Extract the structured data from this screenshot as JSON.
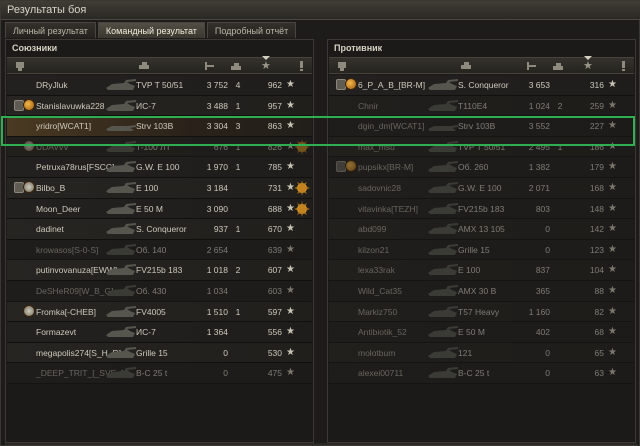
{
  "window": {
    "title": "Результаты боя"
  },
  "tabs": [
    {
      "label": "Личный результат",
      "active": false
    },
    {
      "label": "Командный результат",
      "active": true
    },
    {
      "label": "Подробный отчёт",
      "active": false
    }
  ],
  "allies": {
    "title": "Союзники",
    "rows": [
      {
        "player": "DRyJluk",
        "tank": "TVP T 50/51",
        "damage": "3 752",
        "kills": "4",
        "xp": "962",
        "rank": false,
        "clan": false,
        "dead": false,
        "self": false,
        "medal": false
      },
      {
        "player": "Stanislavuwka228",
        "tank": "ИС-7",
        "damage": "3 488",
        "kills": "1",
        "xp": "957",
        "rank": true,
        "clan": true,
        "dead": false,
        "self": false,
        "medal": false
      },
      {
        "player": "yridro[WCAT1]",
        "tank": "Strv 103B",
        "damage": "3 304",
        "kills": "3",
        "xp": "863",
        "rank": false,
        "clan": false,
        "dead": false,
        "self": true,
        "medal": false
      },
      {
        "player": "UDAVvV",
        "tank": "T-100 ЛТ",
        "damage": "676",
        "kills": "1",
        "xp": "826",
        "rank": false,
        "clan": true,
        "dead": true,
        "self": false,
        "medal": true
      },
      {
        "player": "Petruxa78rus[FSCC]",
        "tank": "G.W. E 100",
        "damage": "1 970",
        "kills": "1",
        "xp": "785",
        "rank": false,
        "clan": false,
        "dead": false,
        "self": false,
        "medal": false
      },
      {
        "player": "Bilbo_B",
        "tank": "E 100",
        "damage": "3 184",
        "kills": "",
        "xp": "731",
        "rank": true,
        "clan": true,
        "dead": false,
        "self": false,
        "medal": true
      },
      {
        "player": "Moon_Deer",
        "tank": "E 50 M",
        "damage": "3 090",
        "kills": "",
        "xp": "688",
        "rank": false,
        "clan": false,
        "dead": false,
        "self": false,
        "medal": true
      },
      {
        "player": "dadinet",
        "tank": "S. Conqueror",
        "damage": "937",
        "kills": "1",
        "xp": "670",
        "rank": false,
        "clan": false,
        "dead": false,
        "self": false,
        "medal": false
      },
      {
        "player": "krowasos[S-0-S]",
        "tank": "Об. 140",
        "damage": "2 654",
        "kills": "",
        "xp": "639",
        "rank": false,
        "clan": false,
        "dead": true,
        "self": false,
        "medal": false
      },
      {
        "player": "putinvovanuza[EWW]",
        "tank": "FV215b 183",
        "damage": "1 018",
        "kills": "2",
        "xp": "607",
        "rank": false,
        "clan": false,
        "dead": false,
        "self": false,
        "medal": false
      },
      {
        "player": "DeSHeR09[W_B_G]",
        "tank": "Об. 430",
        "damage": "1 034",
        "kills": "",
        "xp": "603",
        "rank": false,
        "clan": false,
        "dead": true,
        "self": false,
        "medal": false
      },
      {
        "player": "Fromka[-CHEB]",
        "tank": "FV4005",
        "damage": "1 510",
        "kills": "1",
        "xp": "597",
        "rank": false,
        "clan": true,
        "dead": false,
        "self": false,
        "medal": false
      },
      {
        "player": "Formazevt",
        "tank": "ИС-7",
        "damage": "1 364",
        "kills": "",
        "xp": "556",
        "rank": false,
        "clan": false,
        "dead": false,
        "self": false,
        "medal": false
      },
      {
        "player": "megapolis274[S_H_R]",
        "tank": "Grille 15",
        "damage": "0",
        "kills": "",
        "xp": "530",
        "rank": false,
        "clan": false,
        "dead": false,
        "self": false,
        "medal": false
      },
      {
        "player": "_DEEP_TRIT_[_SVE_]",
        "tank": "B-C 25 t",
        "damage": "0",
        "kills": "",
        "xp": "475",
        "rank": false,
        "clan": false,
        "dead": true,
        "self": false,
        "medal": false
      }
    ]
  },
  "enemies": {
    "title": "Противник",
    "rows": [
      {
        "player": "6_P_A_B_[BR-M]",
        "tank": "S. Conqueror",
        "damage": "3 653",
        "kills": "",
        "xp": "316",
        "rank": true,
        "clan": true,
        "dead": false,
        "medal": false
      },
      {
        "player": "Chnir",
        "tank": "T110E4",
        "damage": "1 024",
        "kills": "2",
        "xp": "259",
        "rank": false,
        "clan": false,
        "dead": true,
        "medal": false
      },
      {
        "player": "dgin_dm[WCAT1]",
        "tank": "Strv 103B",
        "damage": "3 552",
        "kills": "",
        "xp": "227",
        "rank": false,
        "clan": false,
        "dead": true,
        "medal": false
      },
      {
        "player": "max_msu",
        "tank": "TVP T 50/51",
        "damage": "2 495",
        "kills": "1",
        "xp": "186",
        "rank": false,
        "clan": false,
        "dead": true,
        "medal": false
      },
      {
        "player": "pupsikx[BR-M]",
        "tank": "Об. 260",
        "damage": "1 382",
        "kills": "",
        "xp": "179",
        "rank": true,
        "clan": true,
        "dead": true,
        "medal": false
      },
      {
        "player": "sadovnic28",
        "tank": "G.W. E 100",
        "damage": "2 071",
        "kills": "",
        "xp": "168",
        "rank": false,
        "clan": false,
        "dead": true,
        "medal": false
      },
      {
        "player": "vitavinka[TEZH]",
        "tank": "FV215b 183",
        "damage": "803",
        "kills": "",
        "xp": "148",
        "rank": false,
        "clan": false,
        "dead": true,
        "medal": false
      },
      {
        "player": "abd099",
        "tank": "AMX 13 105",
        "damage": "0",
        "kills": "",
        "xp": "142",
        "rank": false,
        "clan": false,
        "dead": true,
        "medal": false
      },
      {
        "player": "kilzon21",
        "tank": "Grille 15",
        "damage": "0",
        "kills": "",
        "xp": "123",
        "rank": false,
        "clan": false,
        "dead": true,
        "medal": false
      },
      {
        "player": "lexa33rak",
        "tank": "E 100",
        "damage": "837",
        "kills": "",
        "xp": "104",
        "rank": false,
        "clan": false,
        "dead": true,
        "medal": false
      },
      {
        "player": "Wild_Cat35",
        "tank": "AMX 30 B",
        "damage": "365",
        "kills": "",
        "xp": "88",
        "rank": false,
        "clan": false,
        "dead": true,
        "medal": false
      },
      {
        "player": "Markiz750",
        "tank": "T57 Heavy",
        "damage": "1 160",
        "kills": "",
        "xp": "82",
        "rank": false,
        "clan": false,
        "dead": true,
        "medal": false
      },
      {
        "player": "Antibiotik_52",
        "tank": "E 50 M",
        "damage": "402",
        "kills": "",
        "xp": "68",
        "rank": false,
        "clan": false,
        "dead": true,
        "medal": false
      },
      {
        "player": "molotbum",
        "tank": "121",
        "damage": "0",
        "kills": "",
        "xp": "65",
        "rank": false,
        "clan": false,
        "dead": true,
        "medal": false
      },
      {
        "player": "alexei00711",
        "tank": "B-C 25 t",
        "damage": "0",
        "kills": "",
        "xp": "63",
        "rank": false,
        "clan": false,
        "dead": true,
        "medal": false
      }
    ]
  },
  "colors": {
    "accent_highlight": "#2fae52",
    "self_row": "#4a3a22",
    "medal_gold": "#e0a030"
  },
  "icons": {
    "xp_star": "★"
  }
}
